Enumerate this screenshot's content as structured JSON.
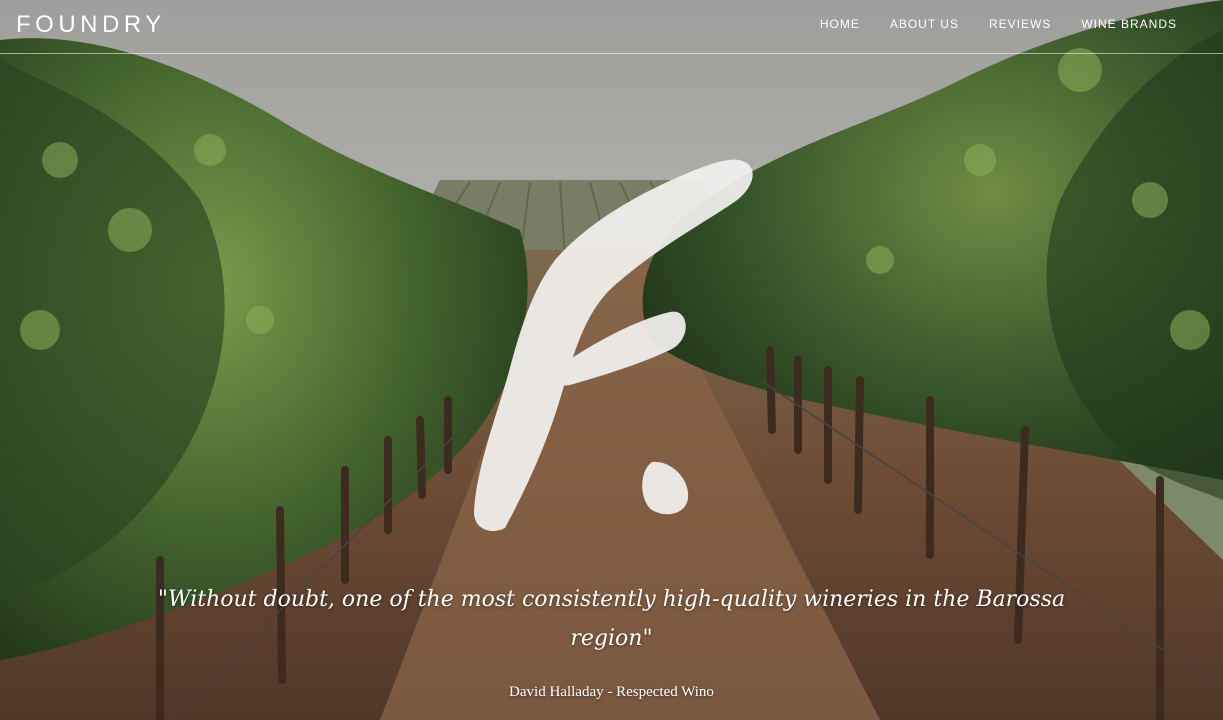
{
  "header": {
    "logo": "FOUNDRY",
    "nav": [
      {
        "label": "HOME"
      },
      {
        "label": "ABOUT US"
      },
      {
        "label": "REVIEWS"
      },
      {
        "label": "WINE BRANDS"
      }
    ]
  },
  "hero": {
    "background": "vineyard-rows-photo",
    "brand_mark_icon": "foundry-f-brush-mark-icon",
    "quote": "\"Without doubt, one of the most consistently high-quality wineries in the Barossa region\"",
    "attribution": "David Halladay - Respected Wino"
  },
  "colors": {
    "sky": "#a6a6a3",
    "foliage_dark": "#2e4a22",
    "foliage_light": "#6f8f45",
    "soil": "#6b4a34",
    "text": "#ffffff"
  }
}
